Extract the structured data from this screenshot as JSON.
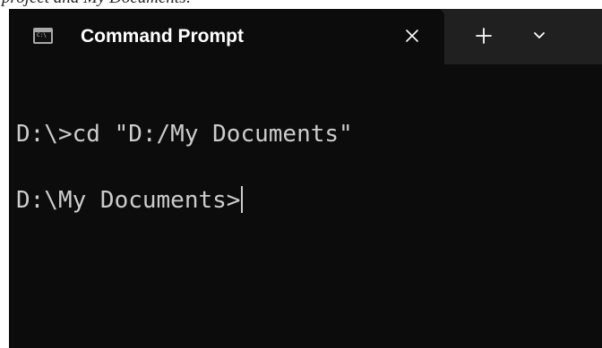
{
  "caption": {
    "text": "project and My Documents:"
  },
  "window": {
    "tab": {
      "title": "Command Prompt",
      "icon": "command-prompt-icon",
      "icon_glyph": "C:\\"
    },
    "controls": {
      "close_icon": "close-icon",
      "new_tab_icon": "plus-icon",
      "dropdown_icon": "chevron-down-icon"
    },
    "colors": {
      "terminal_background": "#0c0c0c",
      "titlebar_background": "#202020",
      "text": "#cccccc",
      "title_text": "#ffffff"
    }
  },
  "terminal": {
    "lines": [
      "D:\\>cd \"D:/My Documents\"",
      "D:\\My Documents>"
    ]
  }
}
